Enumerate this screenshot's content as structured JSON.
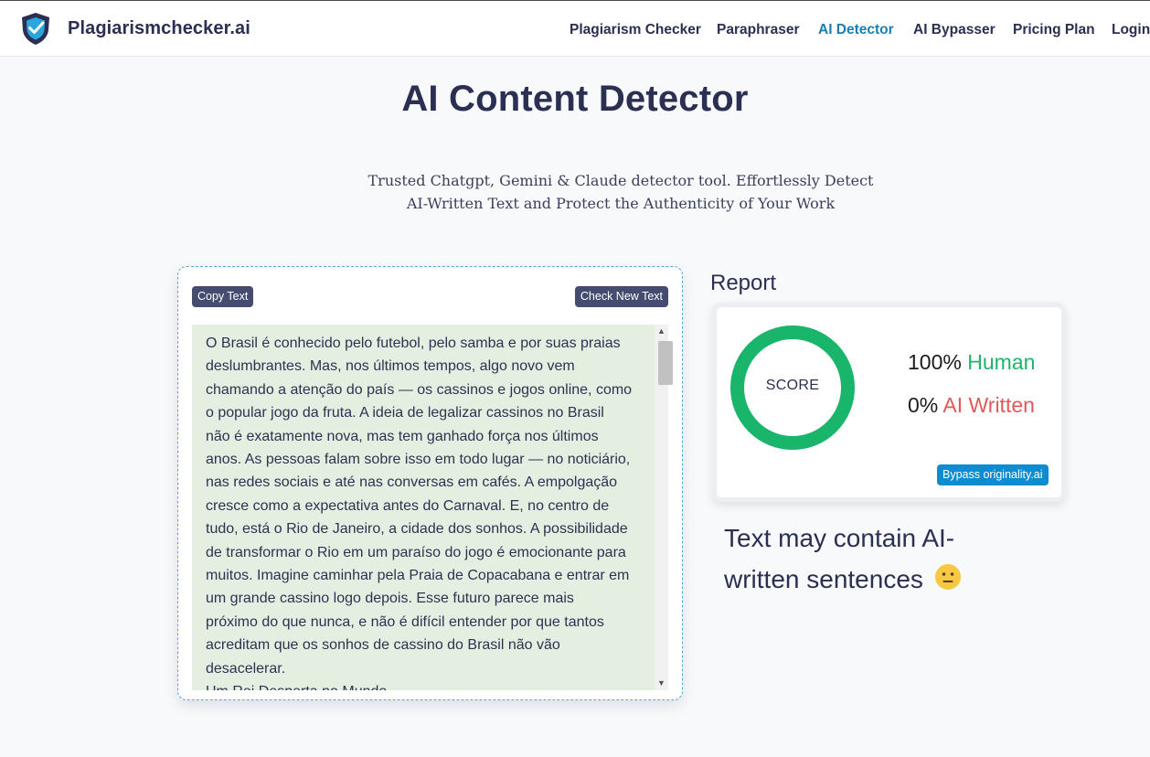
{
  "header": {
    "brand": "Plagiarismchecker.ai",
    "nav": [
      {
        "label": "Plagiarism Checker",
        "active": false
      },
      {
        "label": "Paraphraser",
        "active": false
      },
      {
        "label": "AI Detector",
        "active": true
      },
      {
        "label": "AI Bypasser",
        "active": false
      },
      {
        "label": "Pricing Plan",
        "active": false
      },
      {
        "label": "Login",
        "active": false
      }
    ],
    "logo_icon": "shield-check-icon"
  },
  "hero": {
    "title": "AI Content Detector",
    "subtitle_line1": "Trusted Chatgpt, Gemini & Claude detector tool. Effortlessly Detect",
    "subtitle_line2": "AI-Written Text and Protect the Authenticity of Your Work"
  },
  "editor": {
    "copy_label": "Copy Text",
    "new_label": "Check New Text",
    "text": "O Brasil é conhecido pelo futebol, pelo samba e por suas praias\ndeslumbrantes. Mas, nos últimos tempos, algo novo vem\nchamando a atenção do país — os cassinos e jogos online, como\no popular jogo da fruta. A ideia de legalizar cassinos no Brasil\nnão é exatamente nova, mas tem ganhado força nos últimos\nanos. As pessoas falam sobre isso em todo lugar — no noticiário,\nnas redes sociais e até nas conversas em cafés. A empolgação\ncresce como a expectativa antes do Carnaval. E, no centro de\ntudo, está o Rio de Janeiro, a cidade dos sonhos. A possibilidade\nde transformar o Rio em um paraíso do jogo é emocionante para\nmuitos. Imagine caminhar pela Praia de Copacabana e entrar em\num grande cassino logo depois. Esse futuro parece mais\npróximo do que nunca, e não é difícil entender por que tantos\nacreditam que os sonhos de cassino do Brasil não vão\ndesacelerar.\nUm Rei Desperta no Mundo"
  },
  "report": {
    "title": "Report",
    "score_label": "SCORE",
    "human_percent": "100%",
    "human_label": "Human",
    "ai_percent": "0%",
    "ai_label": "AI Written",
    "bypass_label": "Bypass originality.ai",
    "verdict": "Text may contain AI-written sentences",
    "verdict_icon": "neutral-face-icon"
  },
  "colors": {
    "brand_dark": "#2b2f52",
    "accent_blue": "#1a7fb0",
    "human_green": "#18b56b",
    "ai_red": "#e05a5a",
    "button_dark": "#454c70",
    "text_bg": "#e4efe2"
  }
}
